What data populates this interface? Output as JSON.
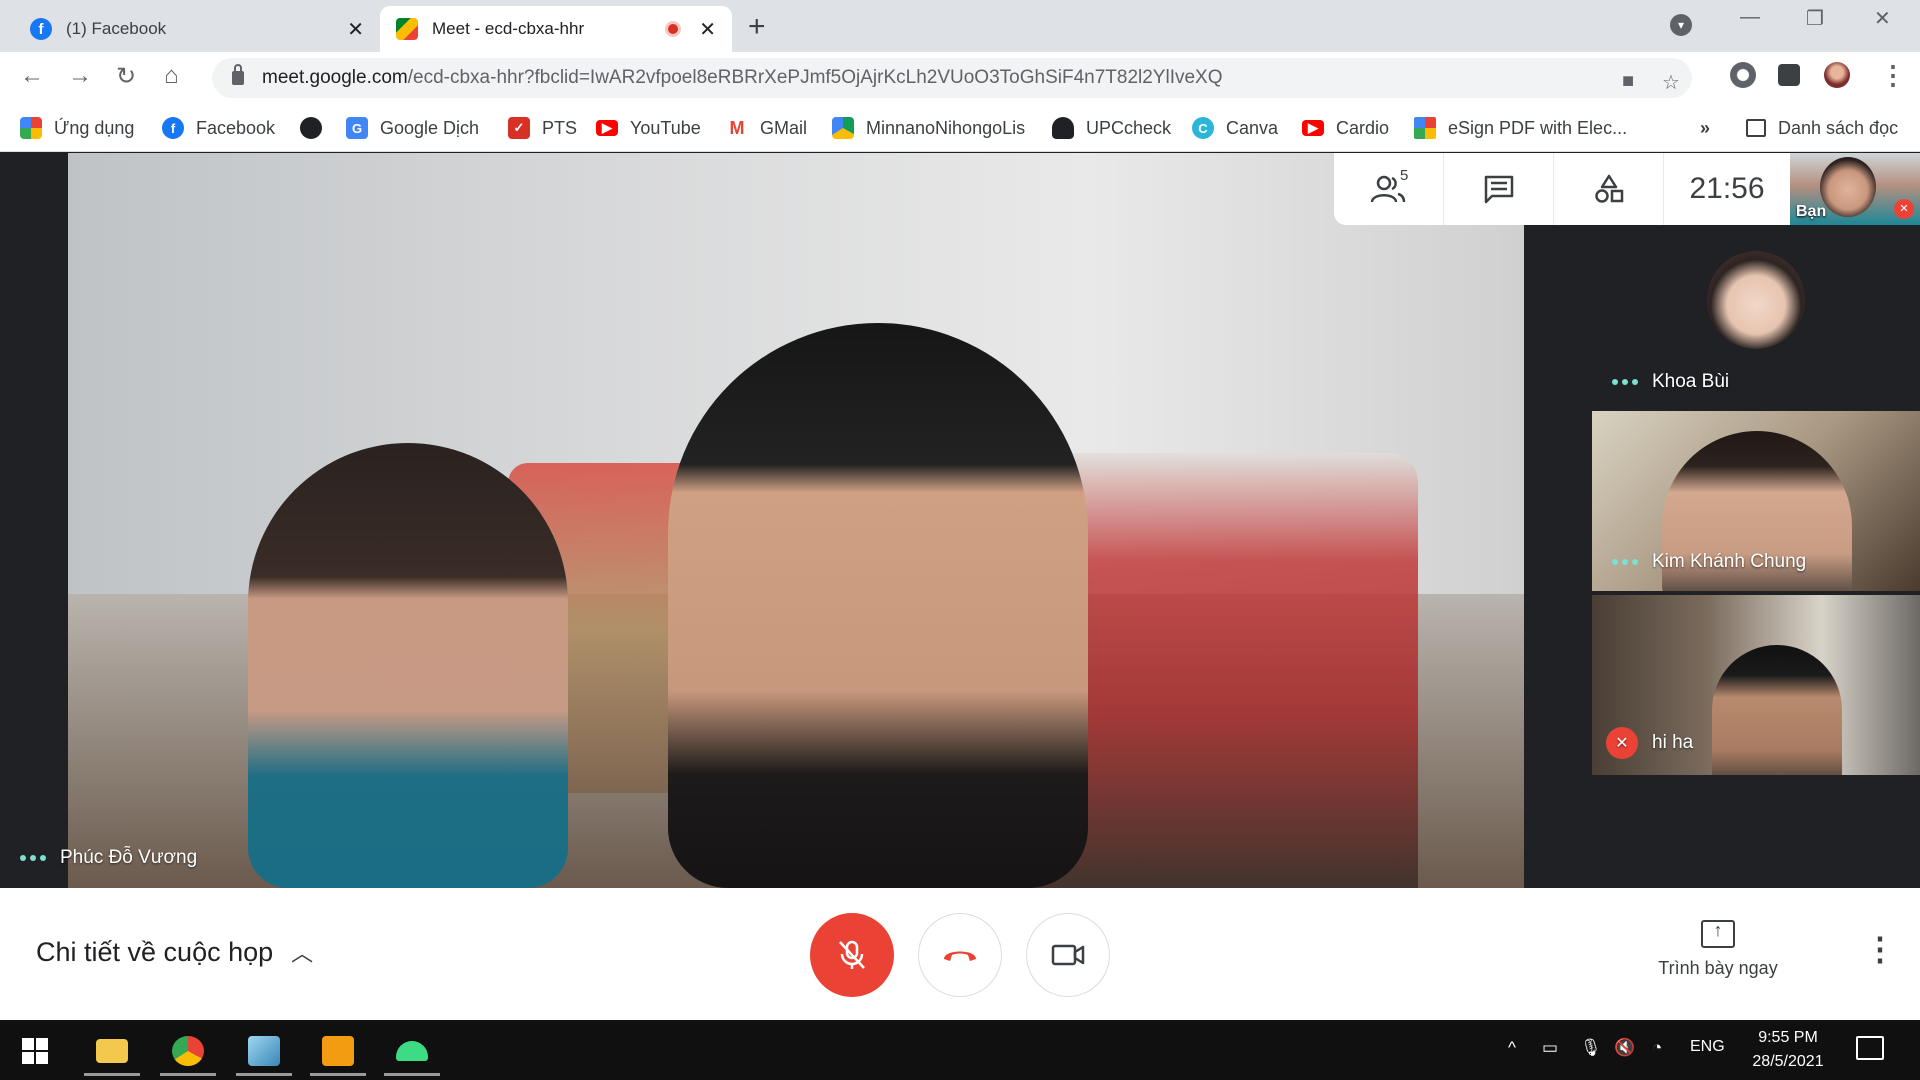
{
  "browser": {
    "tabs": [
      {
        "title": "(1) Facebook",
        "active": false,
        "favicon": "facebook-icon"
      },
      {
        "title": "Meet - ecd-cbxa-hhr",
        "active": true,
        "favicon": "google-meet-icon",
        "recording": true
      }
    ],
    "url_host": "meet.google.com",
    "url_path": "/ecd-cbxa-hhr?fbclid=IwAR2vfpoel8eRBRrXePJmf5OjAjrKcLh2VUoO3ToGhSiF4n7T82l2YlIveXQ",
    "bookmarks": [
      {
        "label": "Ứng dụng",
        "icon": "apps-grid-icon"
      },
      {
        "label": "Facebook",
        "icon": "facebook-icon"
      },
      {
        "label": "",
        "icon": "globe-icon"
      },
      {
        "label": "Google Dịch",
        "icon": "google-translate-icon"
      },
      {
        "label": "PTS",
        "icon": "pts-icon"
      },
      {
        "label": "YouTube",
        "icon": "youtube-icon"
      },
      {
        "label": "GMail",
        "icon": "gmail-icon"
      },
      {
        "label": "MinnanoNihongoLis",
        "icon": "google-drive-icon"
      },
      {
        "label": "UPCcheck",
        "icon": "linux-tux-icon"
      },
      {
        "label": "Canva",
        "icon": "canva-icon"
      },
      {
        "label": "Cardio",
        "icon": "youtube-icon"
      },
      {
        "label": "eSign PDF with Elec...",
        "icon": "esign-icon"
      }
    ],
    "bookmarks_overflow": "»",
    "reading_list": "Danh sách đọc"
  },
  "meet": {
    "participant_count": "5",
    "clock": "21:56",
    "self_label": "Bạn",
    "main_speaker": "Phúc Đỗ Vương",
    "participants": [
      {
        "name": "Khoa Bùi",
        "state": "speaking"
      },
      {
        "name": "Kim Khánh Chung",
        "state": "speaking"
      },
      {
        "name": "hi ha",
        "state": "muted"
      }
    ],
    "details_label": "Chi tiết về cuộc họp",
    "present_label": "Trình bày ngay"
  },
  "taskbar": {
    "language": "ENG",
    "time": "9:55 PM",
    "date": "28/5/2021"
  },
  "colors": {
    "meet_bg": "#202124",
    "mic_off_red": "#ea4335",
    "speaking_dots": "#7ce0d3"
  }
}
